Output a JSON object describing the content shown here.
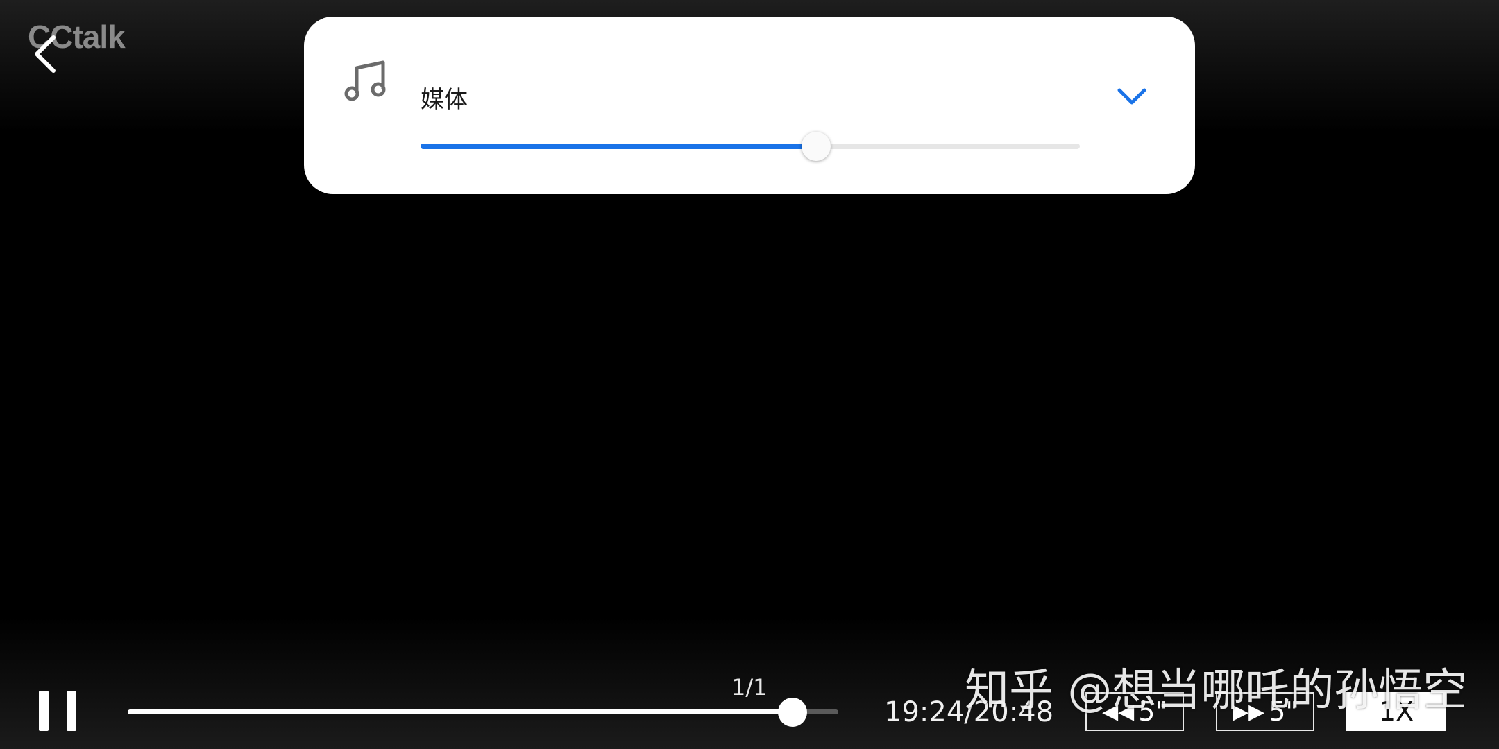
{
  "header": {
    "logo_text": "CCtalk"
  },
  "volume_panel": {
    "label": "媒体",
    "level": 0.6,
    "accent_color": "#1a73e8",
    "icon": "music-note-icon",
    "collapse_icon": "chevron-down-icon"
  },
  "player": {
    "page_indicator": "1/1",
    "progress": 0.936,
    "time": "19:24/20:48",
    "rewind_label": "5\"",
    "forward_label": "5\"",
    "speed_label": "1X"
  },
  "watermark": {
    "text": "知乎 @想当哪吒的孙悟空"
  }
}
